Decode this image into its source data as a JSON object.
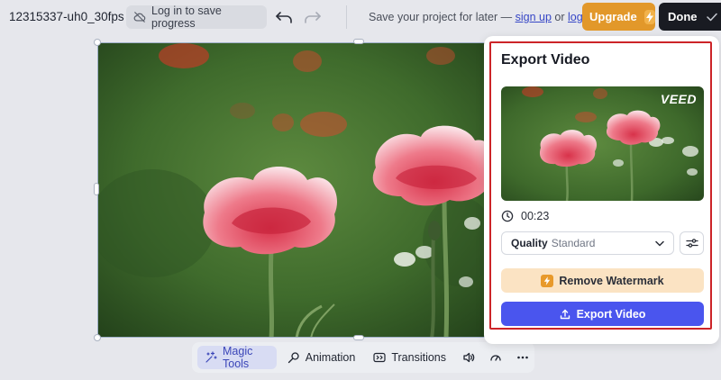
{
  "header": {
    "project_title": "12315337-uh0_30fps",
    "login_save_label": "Log in to save progress",
    "save_prompt_prefix": "Save your project for later —",
    "sign_up_link": "sign up",
    "or_text": "or",
    "log_in_link": "log in",
    "upgrade_label": "Upgrade",
    "done_label": "Done"
  },
  "toolbar": {
    "magic_tools_label": "Magic Tools",
    "animation_label": "Animation",
    "transitions_label": "Transitions"
  },
  "export_panel": {
    "title": "Export Video",
    "watermark": "VEED",
    "duration": "00:23",
    "quality_label": "Quality",
    "quality_value": "Standard",
    "remove_watermark_label": "Remove Watermark",
    "export_button_label": "Export Video"
  },
  "colors": {
    "upgrade": "#e2982a",
    "done": "#191b22",
    "export_button": "#4a55ee",
    "remove_watermark_bg": "#fbe3c3",
    "highlight": "#cc2428",
    "link": "#3646c6"
  },
  "icons": {
    "login_save": "cloud-off-icon",
    "undo": "undo-icon",
    "redo": "redo-icon",
    "upgrade": "bolt-icon",
    "done": "check-icon",
    "magic_tools": "sparkles-icon",
    "animation": "animation-icon",
    "transitions": "transitions-icon",
    "audio": "speaker-icon",
    "speed": "speedometer-icon",
    "more": "more-horizontal-icon",
    "duration": "clock-icon",
    "quality_dropdown": "chevron-down-icon",
    "quality_settings": "sliders-icon",
    "remove_watermark": "bolt-icon",
    "export": "upload-icon"
  }
}
